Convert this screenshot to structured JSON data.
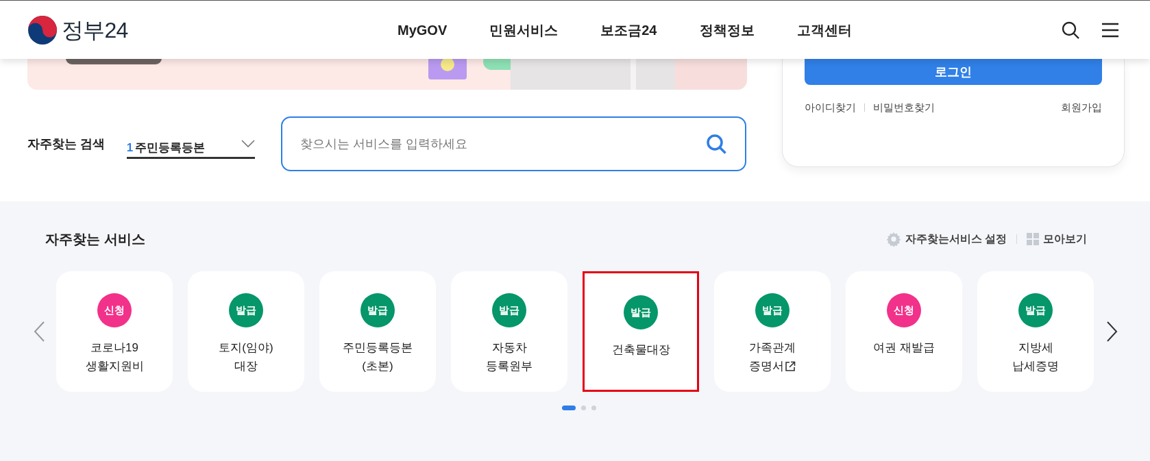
{
  "header": {
    "logo_text": "정부24",
    "nav": [
      {
        "label": "MyGOV"
      },
      {
        "label": "민원서비스"
      },
      {
        "label": "보조금24"
      },
      {
        "label": "정책정보"
      },
      {
        "label": "고객센터"
      }
    ]
  },
  "frequent_search": {
    "label": "자주찾는 검색",
    "rank": "1",
    "term": "주민등록등본"
  },
  "search": {
    "placeholder": "찾으시는 서비스를 입력하세요"
  },
  "login": {
    "button": "로그인",
    "links": [
      {
        "label": "아이디찾기"
      },
      {
        "label": "비밀번호찾기"
      }
    ],
    "signup": "회원가입"
  },
  "services": {
    "title": "자주찾는 서비스",
    "settings": "자주찾는서비스 설정",
    "view_all": "모아보기",
    "items": [
      {
        "badge": "신청",
        "kind": "apply",
        "lines": [
          "코로나19",
          "생활지원비"
        ],
        "external": false,
        "selected": false
      },
      {
        "badge": "발급",
        "kind": "issue",
        "lines": [
          "토지(임야)",
          "대장"
        ],
        "external": false,
        "selected": false
      },
      {
        "badge": "발급",
        "kind": "issue",
        "lines": [
          "주민등록등본",
          "(초본)"
        ],
        "external": false,
        "selected": false
      },
      {
        "badge": "발급",
        "kind": "issue",
        "lines": [
          "자동차",
          "등록원부"
        ],
        "external": false,
        "selected": false
      },
      {
        "badge": "발급",
        "kind": "issue",
        "lines": [
          "건축물대장"
        ],
        "external": false,
        "selected": true
      },
      {
        "badge": "발급",
        "kind": "issue",
        "lines": [
          "가족관계",
          "증명서"
        ],
        "external": true,
        "selected": false
      },
      {
        "badge": "신청",
        "kind": "apply",
        "lines": [
          "여권 재발급"
        ],
        "external": false,
        "selected": false
      },
      {
        "badge": "발급",
        "kind": "issue",
        "lines": [
          "지방세",
          "납세증명"
        ],
        "external": false,
        "selected": false
      }
    ],
    "pages": [
      {
        "selected": true
      },
      {
        "selected": false
      },
      {
        "selected": false
      }
    ]
  }
}
